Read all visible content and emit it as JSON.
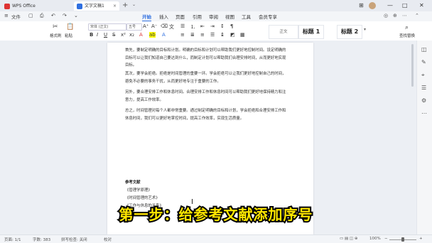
{
  "titlebar": {
    "app_tab": "WPS Office",
    "doc_tab": "文字文稿1",
    "close_glyph": "×",
    "add_tab": "+",
    "chevron": "⌄",
    "min": "—",
    "max": "□",
    "close": "✕",
    "grid": "⊞"
  },
  "menubar": {
    "hamburger": "≡",
    "file_label": "文件",
    "icons": [
      "▢",
      "⎙",
      "↶",
      "↷",
      "⌄"
    ],
    "items": [
      "开始",
      "插入",
      "页面",
      "引用",
      "审阅",
      "视图",
      "工具",
      "会员专享"
    ],
    "active_index": 0,
    "right_icons": [
      "◎",
      "⊕",
      "⋯",
      "⌃"
    ]
  },
  "ribbon": {
    "format_painter": "格式刷",
    "paste": "粘贴",
    "font_name": "宋体 (正文)",
    "font_size": "五号",
    "bold": "B",
    "italic": "I",
    "underline": "U",
    "style_normal": "正文",
    "style_h1": "标题 1",
    "style_h2": "标题 2",
    "find_replace": "查找替换"
  },
  "document": {
    "paragraphs": [
      "首先，要制定明确的目标和计划。明确的目标和计划可以帮助我们更好地控制时间。设定明确的目标可以让我们知道自己要达到什么，而制定计划可以帮助我们合理安排时间，从而更好地实现目标。",
      "其次，要学会拒绝。拒绝是时间管理的重要一环。学会拒绝可以让我们更好地控制自己的时间，避免不必要的事务干扰，从而更好地专注于重要的工作。",
      "另外，要合理安排工作和休息时间。合理安排工作和休息时间可以帮助我们更好地保持精力和注意力，提高工作效率。",
      "总之，时间管理对每个人都非常重要。通过制定明确的目标和计划，学会拒绝和合理安排工作和休息时间，我们可以更好地掌控时间，提高工作效率，实现生活质量。"
    ],
    "references_title": "参考文献",
    "references": [
      "《管理学原理》",
      "《时间管理的艺术》",
      "《工作与休息的关系》"
    ]
  },
  "subtitle": "第一步：给参考文献添加序号",
  "statusbar": {
    "page": "页面: 1/1",
    "words": "字数: 383",
    "spellcheck": "拼写检查: 关闭",
    "proofread": "校对",
    "zoom": "100%",
    "zoom_minus": "−",
    "zoom_plus": "+"
  },
  "right_panel_icons": [
    "◫",
    "✎",
    "⌖",
    "☰",
    "⚙",
    "⋯"
  ]
}
